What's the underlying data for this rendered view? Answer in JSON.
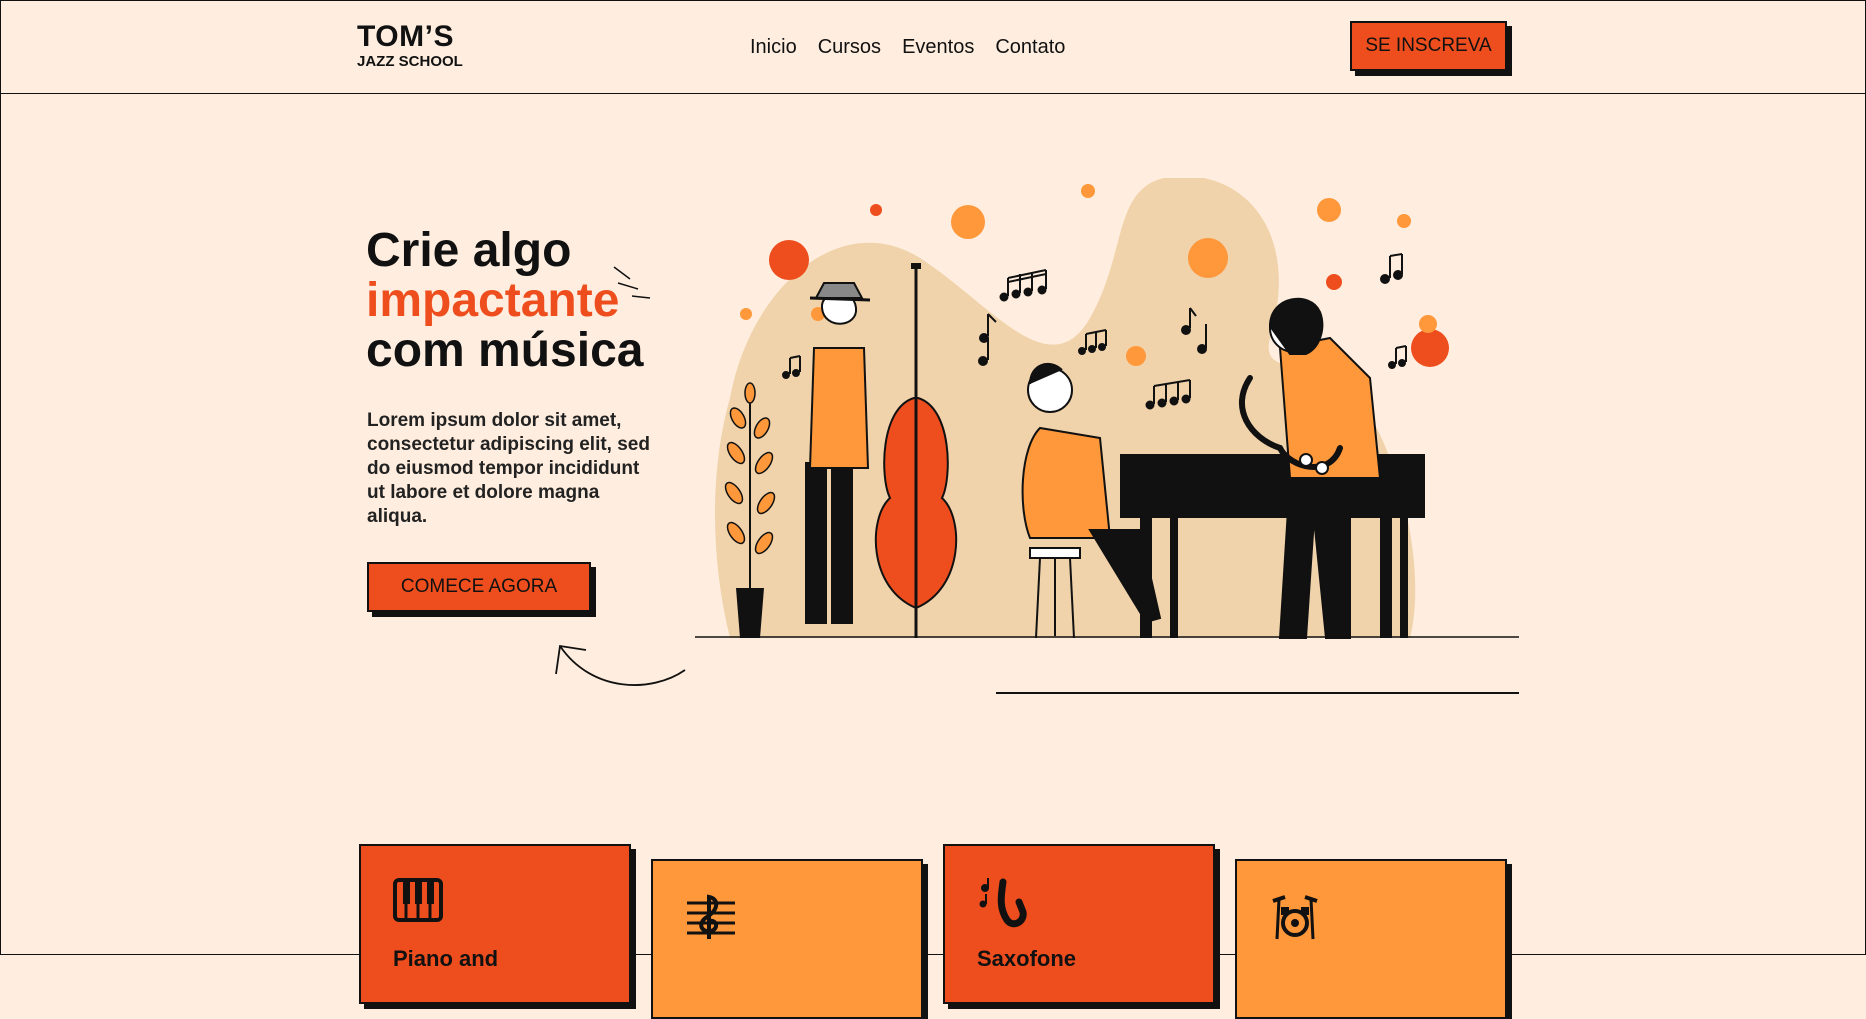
{
  "header": {
    "logo_title": "TOM’S",
    "logo_subtitle": "JAZZ SCHOOL",
    "nav": [
      "Inicio",
      "Cursos",
      "Eventos",
      "Contato"
    ],
    "cta_label": "SE INSCREVA"
  },
  "hero": {
    "title_line1": "Crie algo",
    "title_line2": "impactante",
    "title_line3": "com música",
    "description": "Lorem ipsum dolor sit amet, consectetur adipiscing elit, sed do eiusmod tempor incididunt ut labore et dolore magna aliqua.",
    "cta_label": "COMECE AGORA"
  },
  "cards": [
    {
      "icon": "piano-keys-icon",
      "label": "Piano and"
    },
    {
      "icon": "treble-clef-icon",
      "label": ""
    },
    {
      "icon": "saxophone-icon",
      "label": "Saxofone"
    },
    {
      "icon": "drum-kit-icon",
      "label": ""
    }
  ],
  "colors": {
    "background": "#ffeedf",
    "accent_red": "#ee4e1e",
    "accent_orange": "#fe983a",
    "ink": "#111111",
    "blob": "#f0d3ab"
  }
}
